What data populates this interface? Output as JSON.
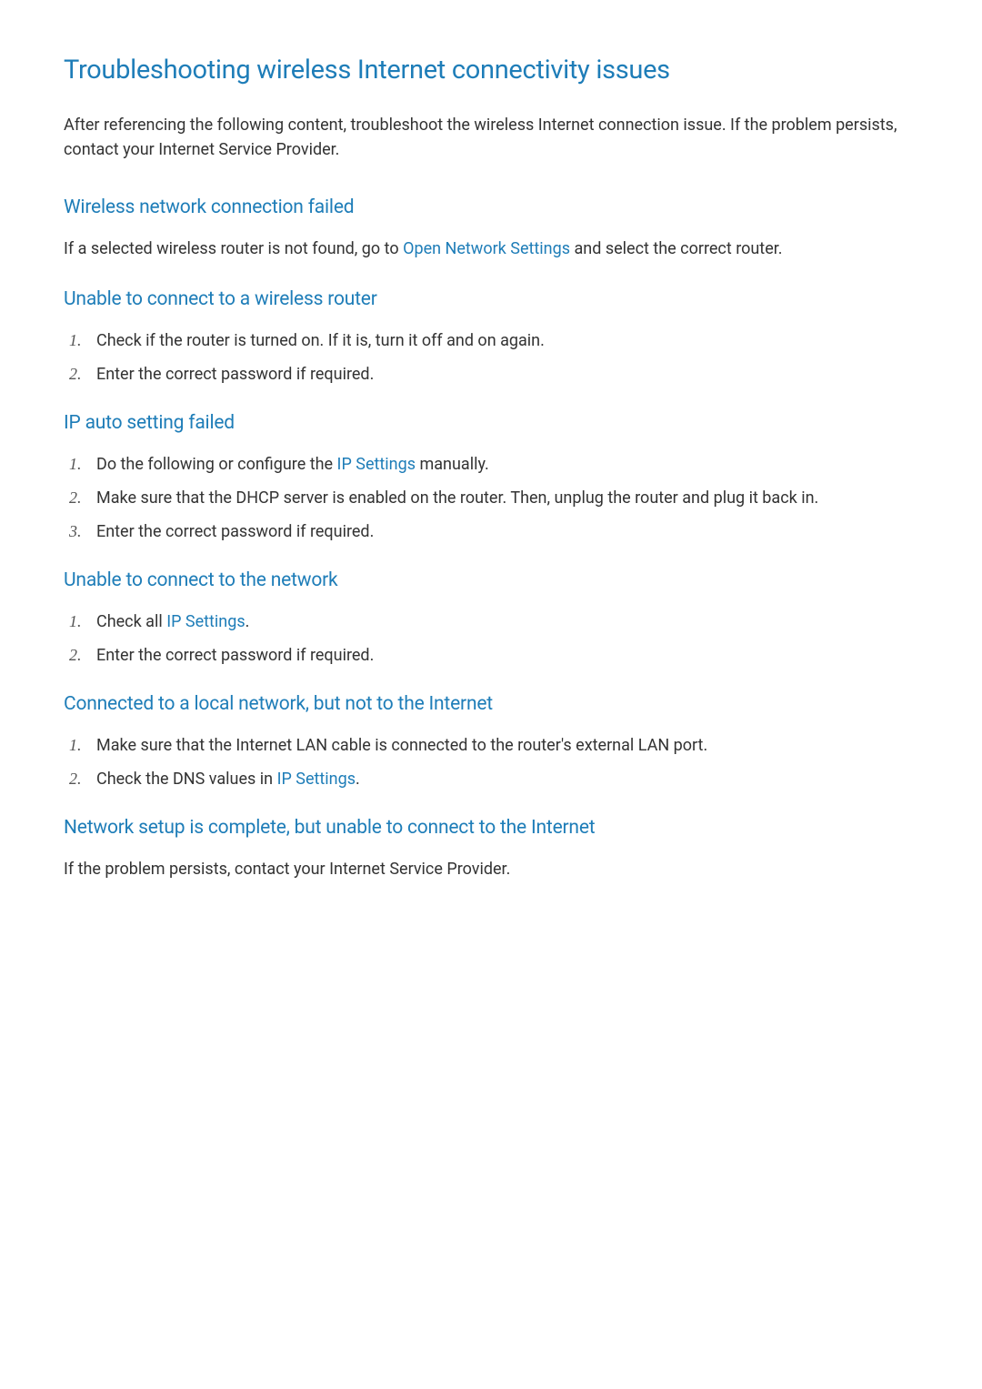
{
  "main_title": "Troubleshooting wireless Internet connectivity issues",
  "intro": "After referencing the following content, troubleshoot the wireless Internet connection issue. If the problem persists, contact your Internet Service Provider.",
  "sections": {
    "s1": {
      "heading": "Wireless network connection failed",
      "text_before": "If a selected wireless router is not found, go to ",
      "link": "Open Network Settings",
      "text_after": " and select the correct router."
    },
    "s2": {
      "heading": "Unable to connect to a wireless router",
      "items": {
        "i1": "Check if the router is turned on. If it is, turn it off and on again.",
        "i2": "Enter the correct password if required."
      }
    },
    "s3": {
      "heading": "IP auto setting failed",
      "items": {
        "i1_before": "Do the following or configure the ",
        "i1_link": "IP Settings",
        "i1_after": " manually.",
        "i2": "Make sure that the DHCP server is enabled on the router. Then, unplug the router and plug it back in.",
        "i3": "Enter the correct password if required."
      }
    },
    "s4": {
      "heading": "Unable to connect to the network",
      "items": {
        "i1_before": "Check all ",
        "i1_link": "IP Settings",
        "i1_after": ".",
        "i2": "Enter the correct password if required."
      }
    },
    "s5": {
      "heading": "Connected to a local network, but not to the Internet",
      "items": {
        "i1": "Make sure that the Internet LAN cable is connected to the router's external LAN port.",
        "i2_before": "Check the DNS values in ",
        "i2_link": "IP Settings",
        "i2_after": "."
      }
    },
    "s6": {
      "heading": "Network setup is complete, but unable to connect to the Internet",
      "text": "If the problem persists, contact your Internet Service Provider."
    }
  }
}
